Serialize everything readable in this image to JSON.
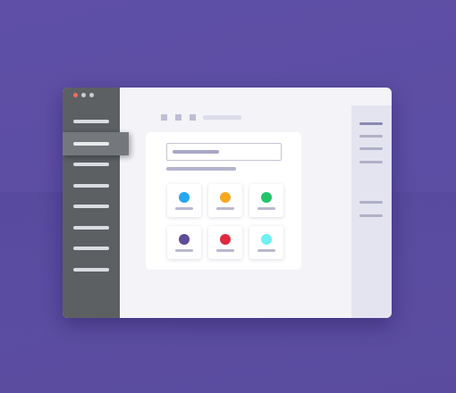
{
  "window": {
    "controls": [
      "close-dot",
      "minimize-dot",
      "maximize-dot"
    ]
  },
  "sidebar": {
    "items": [
      {
        "id": "nav-1",
        "active": false
      },
      {
        "id": "nav-2",
        "active": true
      },
      {
        "id": "nav-3",
        "active": false
      },
      {
        "id": "nav-4",
        "active": false
      },
      {
        "id": "nav-5",
        "active": false
      },
      {
        "id": "nav-6",
        "active": false
      },
      {
        "id": "nav-7",
        "active": false
      },
      {
        "id": "nav-8",
        "active": false
      }
    ]
  },
  "colors": {
    "background": "#5d4fa4",
    "sidebar": "#5c6063",
    "sidebar_active": "#74787c",
    "close_dot": "#ef6f62",
    "window": "#f3f3f8",
    "right_panel": "#e4e4f0"
  },
  "tiles": [
    {
      "color": "#25a7f0"
    },
    {
      "color": "#f7a823"
    },
    {
      "color": "#21c46a"
    },
    {
      "color": "#5d4c97"
    },
    {
      "color": "#e0283e"
    },
    {
      "color": "#6ff0f3"
    }
  ]
}
